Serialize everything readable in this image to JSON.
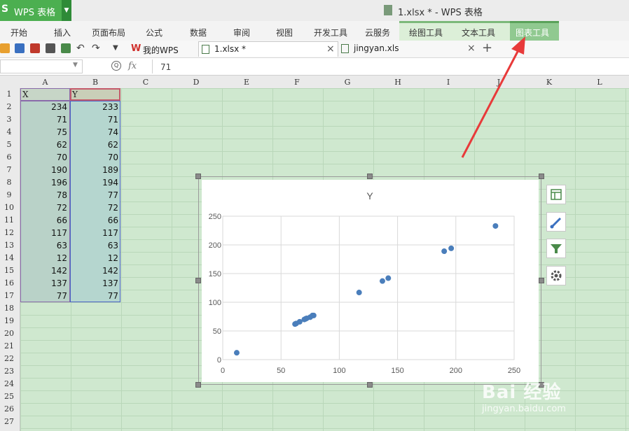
{
  "app": {
    "logo": "S",
    "name": "WPS 表格",
    "window_title": "1.xlsx * - WPS 表格"
  },
  "menu": {
    "tabs": [
      "开始",
      "插入",
      "页面布局",
      "公式",
      "数据",
      "审阅",
      "视图",
      "开发工具",
      "云服务",
      "绘图工具",
      "文本工具",
      "图表工具"
    ],
    "active": "图表工具"
  },
  "doc_tabs": [
    {
      "label": "我的WPS",
      "icon": "wps-logo-icon",
      "active": false
    },
    {
      "label": "1.xlsx *",
      "icon": "spreadsheet-icon",
      "active": true
    },
    {
      "label": "jingyan.xls",
      "icon": "spreadsheet-icon",
      "active": false
    }
  ],
  "formula_bar": {
    "fx": "fx",
    "zoom_label": "Q",
    "value": "71"
  },
  "columns": [
    "A",
    "B",
    "C",
    "D",
    "E",
    "F",
    "G",
    "H",
    "I",
    "J",
    "K",
    "L"
  ],
  "rows": [
    "1",
    "2",
    "3",
    "4",
    "5",
    "6",
    "7",
    "8",
    "9",
    "10",
    "11",
    "12",
    "13",
    "14",
    "15",
    "16",
    "17",
    "18",
    "19",
    "20",
    "21",
    "22",
    "23",
    "24",
    "25",
    "26",
    "27"
  ],
  "sheet": {
    "header": {
      "a": "X",
      "b": "Y"
    },
    "rows": [
      {
        "a": "234",
        "b": "233"
      },
      {
        "a": "71",
        "b": "71"
      },
      {
        "a": "75",
        "b": "74"
      },
      {
        "a": "62",
        "b": "62"
      },
      {
        "a": "70",
        "b": "70"
      },
      {
        "a": "190",
        "b": "189"
      },
      {
        "a": "196",
        "b": "194"
      },
      {
        "a": "78",
        "b": "77"
      },
      {
        "a": "72",
        "b": "72"
      },
      {
        "a": "66",
        "b": "66"
      },
      {
        "a": "117",
        "b": "117"
      },
      {
        "a": "63",
        "b": "63"
      },
      {
        "a": "12",
        "b": "12"
      },
      {
        "a": "142",
        "b": "142"
      },
      {
        "a": "137",
        "b": "137"
      },
      {
        "a": "77",
        "b": "77"
      }
    ]
  },
  "chart_data": {
    "type": "scatter",
    "title": "Y",
    "xlabel": "",
    "ylabel": "",
    "xlim": [
      0,
      250
    ],
    "ylim": [
      0,
      250
    ],
    "xticks": [
      "0",
      "50",
      "100",
      "150",
      "200",
      "250"
    ],
    "yticks": [
      "0",
      "50",
      "100",
      "150",
      "200",
      "250"
    ],
    "grid": true,
    "color": "#4a7ebb",
    "points": [
      [
        234,
        233
      ],
      [
        71,
        71
      ],
      [
        75,
        74
      ],
      [
        62,
        62
      ],
      [
        70,
        70
      ],
      [
        190,
        189
      ],
      [
        196,
        194
      ],
      [
        78,
        77
      ],
      [
        72,
        72
      ],
      [
        66,
        66
      ],
      [
        117,
        117
      ],
      [
        63,
        63
      ],
      [
        12,
        12
      ],
      [
        142,
        142
      ],
      [
        137,
        137
      ],
      [
        77,
        77
      ]
    ]
  },
  "chart_side_buttons": [
    "chart-elements-icon",
    "chart-style-icon",
    "chart-filter-icon",
    "chart-settings-icon"
  ],
  "watermark": {
    "brand": "Bai 经验",
    "url": "jingyan.baidu.com"
  },
  "colors": {
    "accent": "#4caf50",
    "annotation": "#e83a3a",
    "marker": "#4a7ebb"
  }
}
